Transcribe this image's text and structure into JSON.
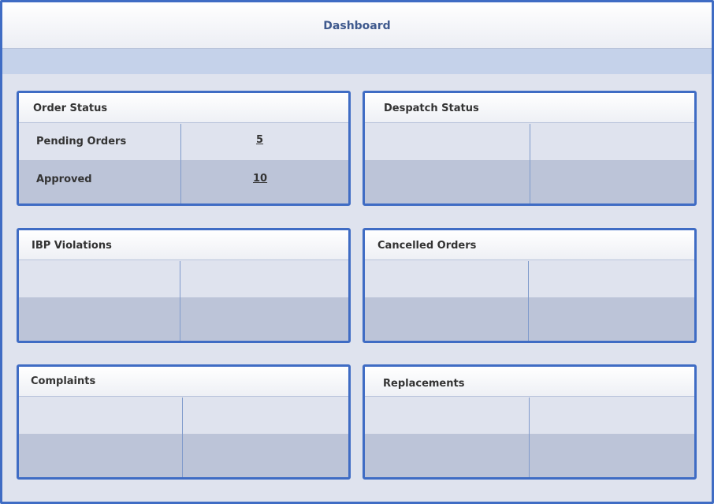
{
  "header": {
    "title": "Dashboard"
  },
  "panels": {
    "order_status": {
      "title": "Order Status",
      "rows": [
        {
          "label": "Pending Orders",
          "value": "5"
        },
        {
          "label": "Approved",
          "value": "10"
        }
      ]
    },
    "despatch_status": {
      "title": "Despatch Status"
    },
    "ibp_violations": {
      "title": "IBP Violations"
    },
    "cancelled_orders": {
      "title": "Cancelled Orders"
    },
    "complaints": {
      "title": "Complaints"
    },
    "replacements": {
      "title": "Replacements"
    }
  },
  "colors": {
    "accent": "#3f6cc4",
    "header_text": "#3f5a8e",
    "row_light": "#dfe3ee",
    "row_dark": "#bcc4d8"
  }
}
